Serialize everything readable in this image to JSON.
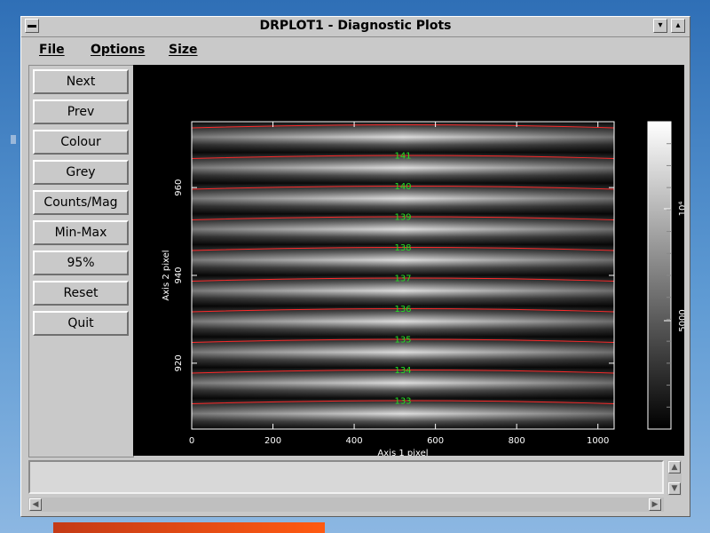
{
  "window": {
    "title": "DRPLOT1 - Diagnostic Plots",
    "minimize_glyph": "▾",
    "maximize_glyph": "▴"
  },
  "menu": {
    "file": "File",
    "options": "Options",
    "size": "Size"
  },
  "buttons": {
    "next": "Next",
    "prev": "Prev",
    "colour": "Colour",
    "grey": "Grey",
    "counts_mag": "Counts/Mag",
    "min_max": "Min-Max",
    "pct95": "95%",
    "reset": "Reset",
    "quit": "Quit"
  },
  "status": {
    "text": ""
  },
  "chart_data": {
    "type": "heatmap",
    "title": "",
    "xlabel": "Axis 1 pixel",
    "ylabel": "Axis 2 pixel",
    "x_ticks": [
      0,
      200,
      400,
      600,
      800,
      1000
    ],
    "y_ticks": [
      920,
      940,
      960
    ],
    "xlim": [
      0,
      1040
    ],
    "ylim": [
      905,
      975
    ],
    "colorbar": {
      "ticks": [
        "5000",
        "10⁴"
      ],
      "range_min_desc": "dark",
      "range_max_desc": "white"
    },
    "trace_labels": [
      "141",
      "140",
      "139",
      "138",
      "137",
      "136",
      "135",
      "134",
      "133"
    ],
    "trace_color": "#ff2a2a",
    "label_color": "#22e022",
    "colormap": "grey"
  }
}
